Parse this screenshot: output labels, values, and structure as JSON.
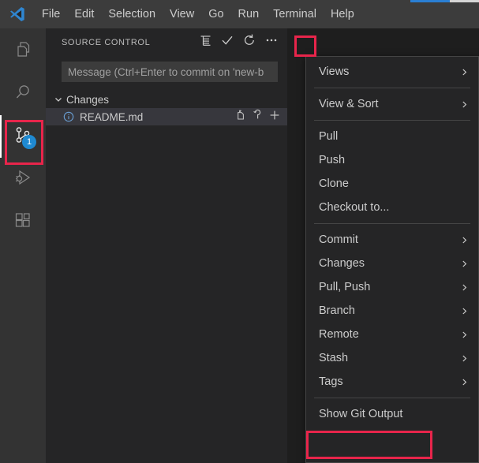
{
  "app": {
    "name": "Visual Studio Code",
    "logo_icon": "vscode-logo-icon"
  },
  "menubar": {
    "items": [
      {
        "label": "File"
      },
      {
        "label": "Edit"
      },
      {
        "label": "Selection"
      },
      {
        "label": "View"
      },
      {
        "label": "Go"
      },
      {
        "label": "Run"
      },
      {
        "label": "Terminal"
      },
      {
        "label": "Help"
      }
    ]
  },
  "activitybar": {
    "items": [
      {
        "name": "explorer",
        "icon": "files-icon",
        "active": false,
        "badge": ""
      },
      {
        "name": "search",
        "icon": "search-icon",
        "active": false,
        "badge": ""
      },
      {
        "name": "source-control",
        "icon": "source-control-icon",
        "active": true,
        "badge": "1"
      },
      {
        "name": "run-and-debug",
        "icon": "run-debug-icon",
        "active": false,
        "badge": ""
      },
      {
        "name": "extensions",
        "icon": "extensions-icon",
        "active": false,
        "badge": ""
      }
    ]
  },
  "sidebar": {
    "title": "SOURCE CONTROL",
    "actions": [
      {
        "name": "view-as-tree",
        "icon": "list-view-icon"
      },
      {
        "name": "commit",
        "icon": "checkmark-icon"
      },
      {
        "name": "refresh",
        "icon": "refresh-icon"
      },
      {
        "name": "more-actions",
        "icon": "ellipsis-icon"
      }
    ],
    "commit_input": {
      "placeholder": "Message (Ctrl+Enter to commit on 'new-b",
      "value": ""
    },
    "changes_group": {
      "label": "Changes",
      "expanded_icon": "chevron-down-icon",
      "resources": [
        {
          "name": "README.md",
          "status_icon": "info-icon",
          "actions": [
            {
              "name": "open-file",
              "icon": "open-file-icon"
            },
            {
              "name": "discard-changes",
              "icon": "discard-icon"
            },
            {
              "name": "stage-changes",
              "icon": "plus-icon"
            }
          ]
        }
      ]
    }
  },
  "context_menu": {
    "items": [
      {
        "label": "Views",
        "submenu": true
      },
      {
        "separator": true
      },
      {
        "label": "View & Sort",
        "submenu": true
      },
      {
        "separator": true
      },
      {
        "label": "Pull",
        "submenu": false
      },
      {
        "label": "Push",
        "submenu": false
      },
      {
        "label": "Clone",
        "submenu": false
      },
      {
        "label": "Checkout to...",
        "submenu": false
      },
      {
        "separator": true
      },
      {
        "label": "Commit",
        "submenu": true
      },
      {
        "label": "Changes",
        "submenu": true
      },
      {
        "label": "Pull, Push",
        "submenu": true
      },
      {
        "label": "Branch",
        "submenu": true
      },
      {
        "label": "Remote",
        "submenu": true
      },
      {
        "label": "Stash",
        "submenu": true
      },
      {
        "label": "Tags",
        "submenu": true
      },
      {
        "separator": true
      },
      {
        "label": "Show Git Output",
        "submenu": false,
        "highlighted": true
      }
    ]
  },
  "annotations": {
    "highlight_color": "#e8254b",
    "boxes": [
      {
        "name": "source-control-activity-icon"
      },
      {
        "name": "more-actions-button"
      },
      {
        "name": "show-git-output-item"
      }
    ]
  },
  "colors": {
    "titlebar_bg": "#3c3c3c",
    "activitybar_bg": "#333333",
    "sidebar_bg": "#252526",
    "editor_bg": "#1e1e1e",
    "badge_bg": "#1f8ad2",
    "accent_blue": "#2a7fd4",
    "separator": "#454545"
  }
}
